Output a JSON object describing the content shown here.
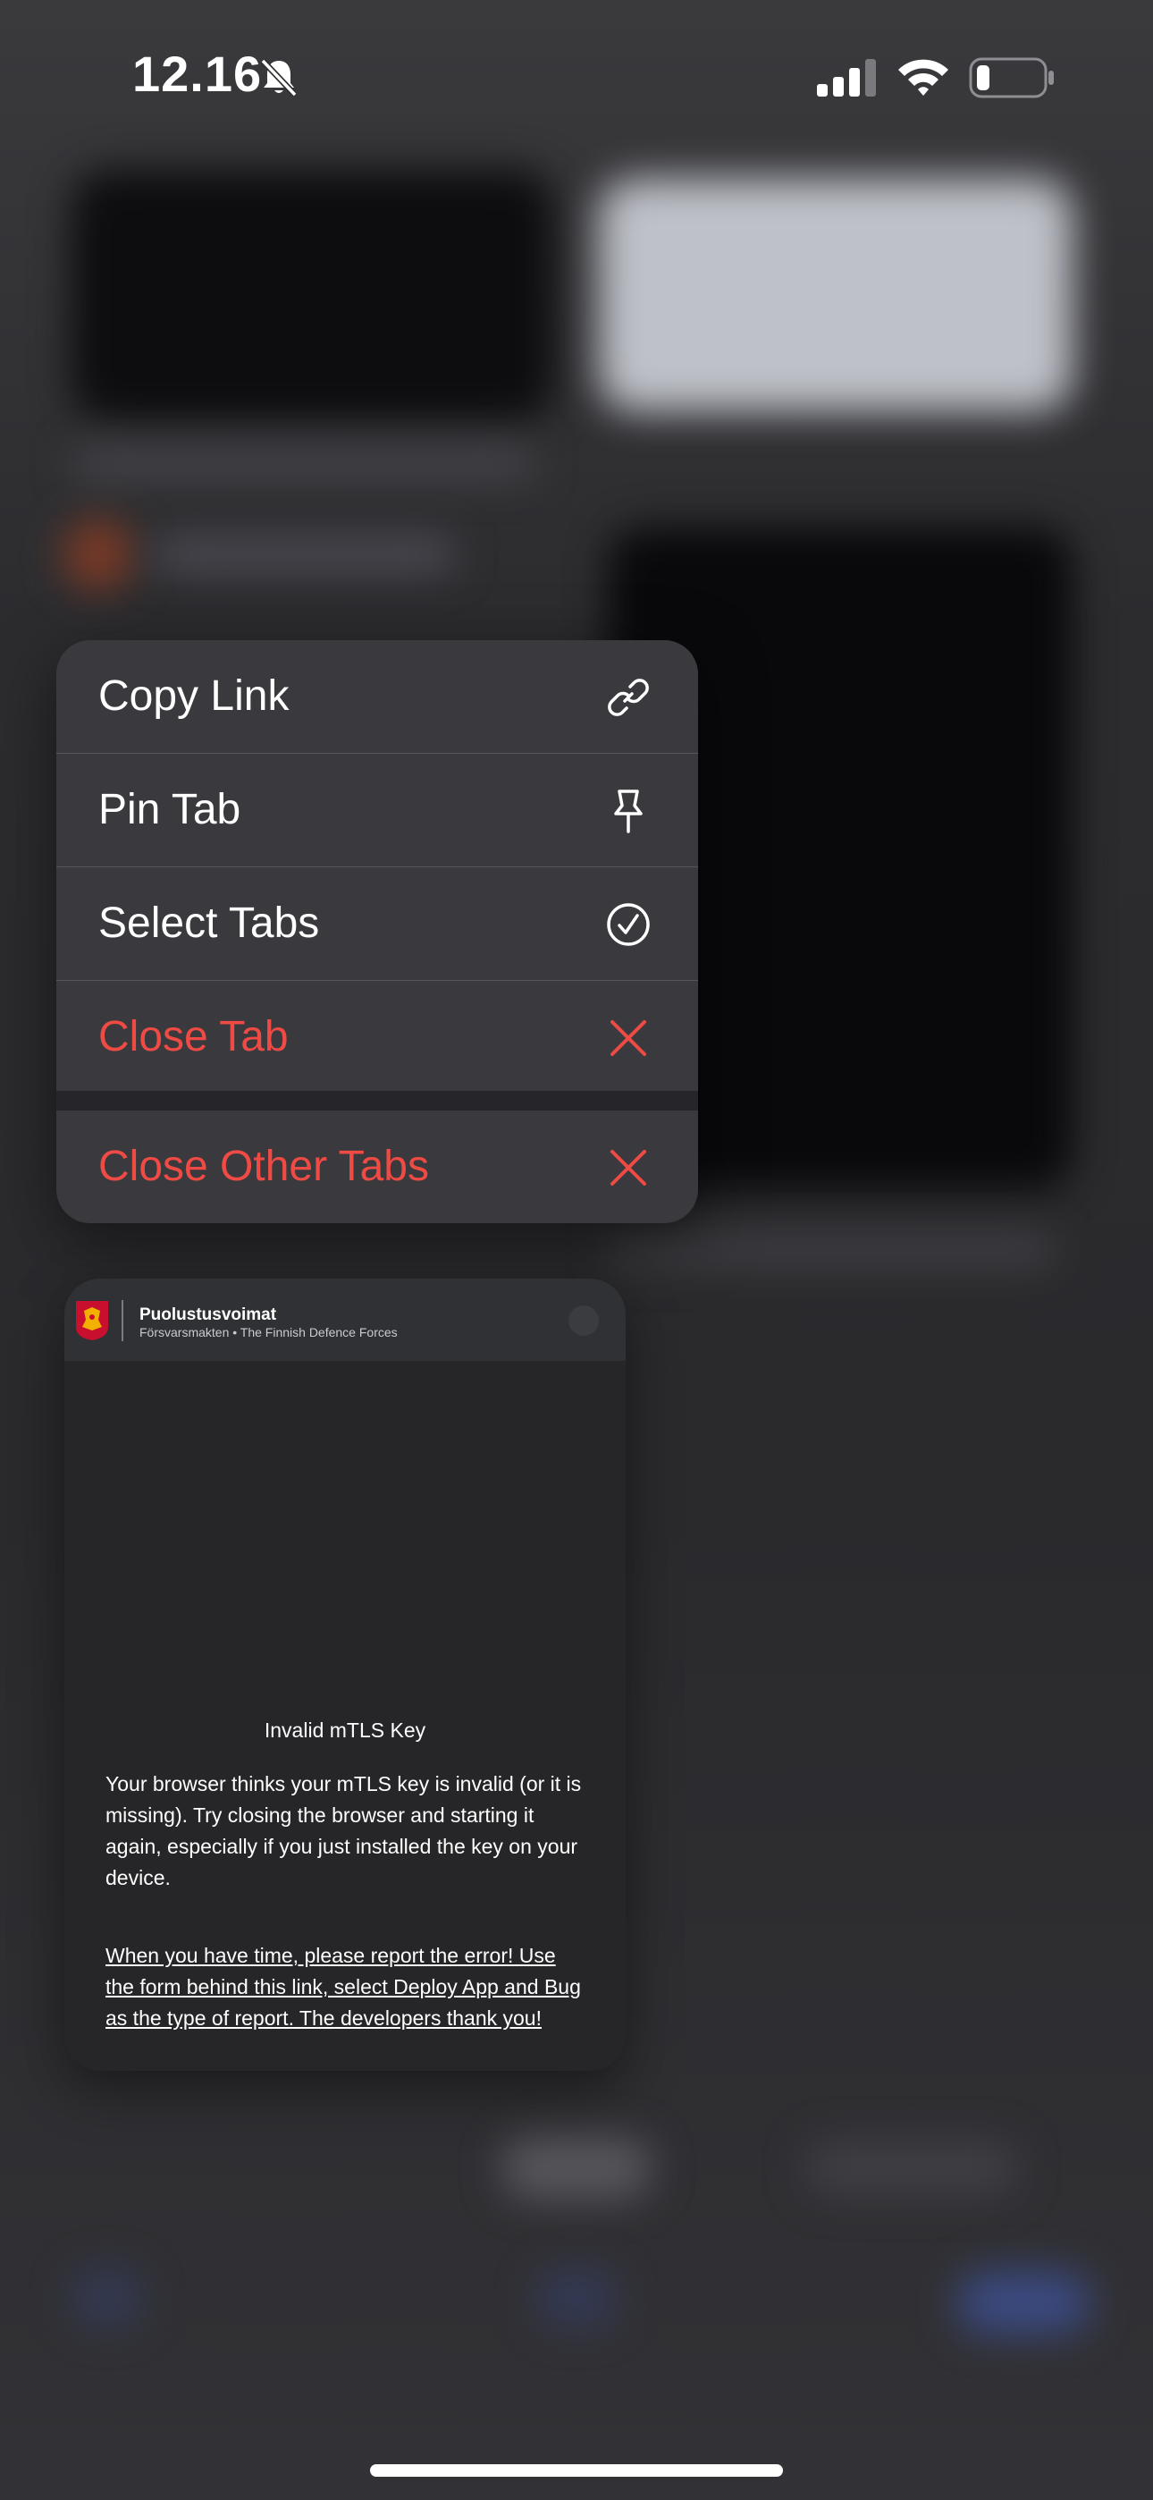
{
  "status_bar": {
    "time": "12.16",
    "icons": [
      "bell-slash-icon",
      "cellular-signal-icon",
      "wifi-icon",
      "battery-low-icon"
    ]
  },
  "context_menu": {
    "items": [
      {
        "label": "Copy Link",
        "icon": "link-icon",
        "destructive": false
      },
      {
        "label": "Pin Tab",
        "icon": "pin-icon",
        "destructive": false
      },
      {
        "label": "Select Tabs",
        "icon": "checkmark-circle-icon",
        "destructive": false
      },
      {
        "label": "Close Tab",
        "icon": "close-x-icon",
        "destructive": true
      }
    ],
    "secondary_items": [
      {
        "label": "Close Other Tabs",
        "icon": "close-x-icon",
        "destructive": true
      }
    ]
  },
  "tab_preview": {
    "site_name": "Puolustusvoimat",
    "site_subtitle": "Försvarsmakten • The Finnish Defence Forces",
    "error_title": "Invalid mTLS Key",
    "error_body": "Your browser thinks your mTLS key is invalid (or it is missing). Try closing the browser and starting it again, especially if you just installed the key on your device.",
    "error_link": "When you have time, please report the error! Use the form behind this link, select Deploy App and Bug as the type of report. The developers thank you!"
  },
  "colors": {
    "destructive": "#ef4b44",
    "menu_background": "#3a3a3e",
    "crest_red": "#c8102e",
    "crest_gold": "#f2b100"
  }
}
